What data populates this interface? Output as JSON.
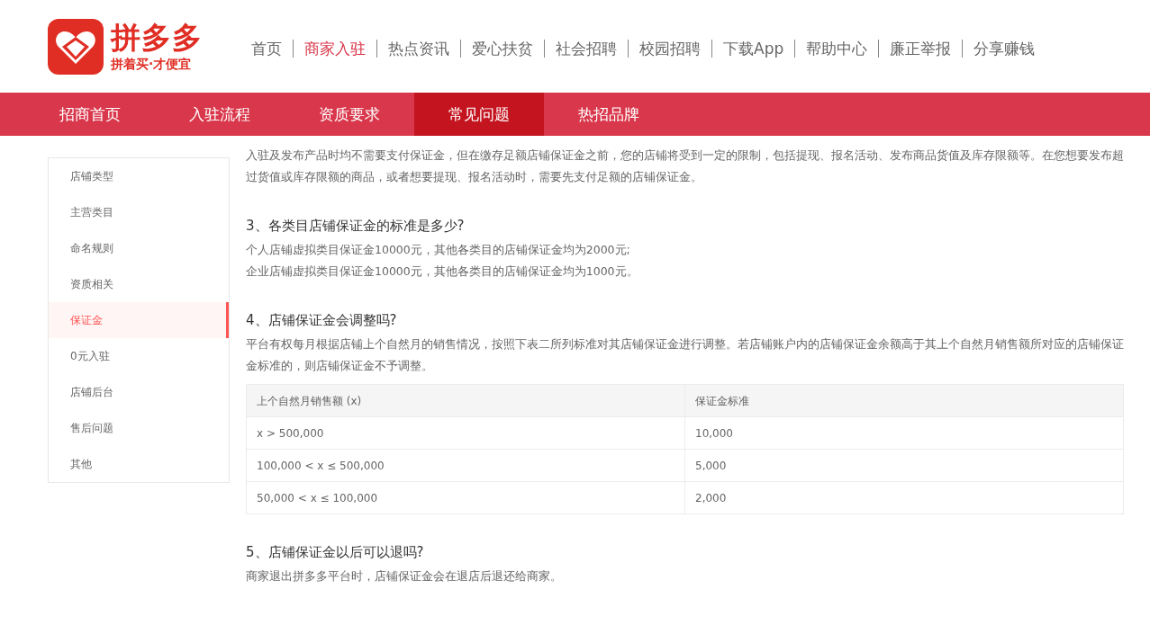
{
  "logo": {
    "name": "拼多多",
    "slogan": "拼着买·才便宜"
  },
  "top_nav": [
    {
      "label": "首页",
      "selected": false
    },
    {
      "label": "商家入驻",
      "selected": true
    },
    {
      "label": "热点资讯",
      "selected": false
    },
    {
      "label": "爱心扶贫",
      "selected": false
    },
    {
      "label": "社会招聘",
      "selected": false
    },
    {
      "label": "校园招聘",
      "selected": false
    },
    {
      "label": "下载App",
      "selected": false
    },
    {
      "label": "帮助中心",
      "selected": false
    },
    {
      "label": "廉正举报",
      "selected": false
    },
    {
      "label": "分享赚钱",
      "selected": false
    }
  ],
  "sub_nav": [
    {
      "label": "招商首页",
      "selected": false
    },
    {
      "label": "入驻流程",
      "selected": false
    },
    {
      "label": "资质要求",
      "selected": false
    },
    {
      "label": "常见问题",
      "selected": true
    },
    {
      "label": "热招品牌",
      "selected": false
    }
  ],
  "sidebar": {
    "items": [
      {
        "label": "店铺类型",
        "selected": false
      },
      {
        "label": "主营类目",
        "selected": false
      },
      {
        "label": "命名规则",
        "selected": false
      },
      {
        "label": "资质相关",
        "selected": false
      },
      {
        "label": "保证金",
        "selected": true
      },
      {
        "label": "0元入驻",
        "selected": false
      },
      {
        "label": "店铺后台",
        "selected": false
      },
      {
        "label": "售后问题",
        "selected": false
      },
      {
        "label": "其他",
        "selected": false
      }
    ]
  },
  "content": [
    {
      "kind": "paragraph",
      "lines": [
        "入驻及发布产品时均不需要支付保证金，但在缴存足额店铺保证金之前，您的店铺将受到一定的限制，包括提现、报名活动、发布商品货值及库存限额等。在您想要发布超过货值或库存限额的商品，或者想要提现、报名活动时，需要先支付足额的店铺保证金。"
      ]
    },
    {
      "kind": "heading",
      "text": "3、各类目店铺保证金的标准是多少?"
    },
    {
      "kind": "paragraph",
      "lines": [
        "个人店铺虚拟类目保证金10000元，其他各类目的店铺保证金均为2000元;",
        "企业店铺虚拟类目保证金10000元，其他各类目的店铺保证金均为1000元。"
      ]
    },
    {
      "kind": "heading",
      "text": "4、店铺保证金会调整吗?"
    },
    {
      "kind": "paragraph",
      "lines": [
        "平台有权每月根据店铺上个自然月的销售情况，按照下表二所列标准对其店铺保证金进行调整。若店铺账户内的店铺保证金余额高于其上个自然月销售额所对应的店铺保证金标准的，则店铺保证金不予调整。"
      ]
    },
    {
      "kind": "table",
      "columns": [
        "上个自然月销售额 (x)",
        "保证金标准"
      ],
      "rows": [
        [
          "x > 500,000",
          "10,000"
        ],
        [
          "100,000 < x ≤ 500,000",
          "5,000"
        ],
        [
          "50,000 < x ≤ 100,000",
          "2,000"
        ]
      ]
    },
    {
      "kind": "heading",
      "text": "5、店铺保证金以后可以退吗?"
    },
    {
      "kind": "paragraph",
      "lines": [
        "商家退出拼多多平台时，店铺保证金会在退店后退还给商家。"
      ]
    }
  ]
}
